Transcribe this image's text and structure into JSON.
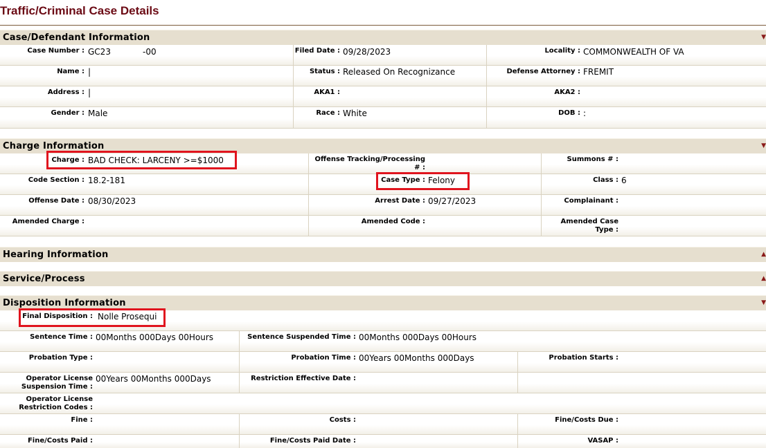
{
  "page": {
    "title": "Traffic/Criminal Case Details"
  },
  "sections": {
    "case": "Case/Defendant Information",
    "charge": "Charge Information",
    "hearing": "Hearing Information",
    "service": "Service/Process",
    "disposition": "Disposition Information"
  },
  "toggle_icons": {
    "collapse": "▼",
    "expand": "▲"
  },
  "case": {
    "case_number": {
      "label": "Case Number :",
      "value": "GC23",
      "suffix": "-00"
    },
    "filed_date": {
      "label": "Filed Date :",
      "value": "09/28/2023"
    },
    "locality": {
      "label": "Locality :",
      "value": "COMMONWEALTH OF VA"
    },
    "name": {
      "label": "Name :",
      "value": "|"
    },
    "status": {
      "label": "Status :",
      "value": "Released On Recognizance"
    },
    "defense_attorney": {
      "label": "Defense Attorney :",
      "value": "FREMIT"
    },
    "address": {
      "label": "Address :",
      "value": "|"
    },
    "aka1": {
      "label": "AKA1 :",
      "value": ""
    },
    "aka2": {
      "label": "AKA2 :",
      "value": ""
    },
    "gender": {
      "label": "Gender :",
      "value": "Male"
    },
    "race": {
      "label": "Race :",
      "value": "White"
    },
    "dob": {
      "label": "DOB :",
      "value": ":"
    }
  },
  "charge": {
    "charge": {
      "label": "Charge :",
      "value": "BAD CHECK: LARCENY >=$1000"
    },
    "offense_tracking_line1": "Offense Tracking/Processing",
    "offense_tracking_line2": "# :",
    "offense_tracking_value": "",
    "summons": {
      "label": "Summons # :",
      "value": ""
    },
    "code_section": {
      "label": "Code Section :",
      "value": "18.2-181"
    },
    "case_type": {
      "label": "Case Type :",
      "value": "Felony"
    },
    "class": {
      "label": "Class :",
      "value": "6"
    },
    "offense_date": {
      "label": "Offense Date :",
      "value": "08/30/2023"
    },
    "arrest_date": {
      "label": "Arrest Date :",
      "value": "09/27/2023"
    },
    "complainant": {
      "label": "Complainant :",
      "value": ""
    },
    "amended_charge": {
      "label": "Amended Charge :",
      "value": ""
    },
    "amended_code": {
      "label": "Amended Code :",
      "value": ""
    },
    "amended_case_type_line1": "Amended Case",
    "amended_case_type_line2": "Type :"
  },
  "disposition": {
    "final_disposition": {
      "label": "Final Disposition :",
      "value": "Nolle Prosequi"
    },
    "sentence_time": {
      "label": "Sentence Time :",
      "value": "00Months 000Days 00Hours"
    },
    "sentence_suspended_time": {
      "label": "Sentence Suspended Time :",
      "value": "00Months 000Days 00Hours"
    },
    "probation_type": {
      "label": "Probation Type :",
      "value": ""
    },
    "probation_time": {
      "label": "Probation Time :",
      "value": "00Years 00Months 000Days"
    },
    "probation_starts": {
      "label": "Probation Starts :",
      "value": ""
    },
    "op_license_suspension_line1": "Operator License",
    "op_license_suspension_line2": "Suspension Time :",
    "op_license_suspension_value": "00Years 00Months 000Days",
    "restriction_effective_date": {
      "label": "Restriction Effective Date :",
      "value": ""
    },
    "op_license_restriction_line1": "Operator License",
    "op_license_restriction_line2": "Restriction Codes :",
    "fine": {
      "label": "Fine :",
      "value": ""
    },
    "costs": {
      "label": "Costs :",
      "value": ""
    },
    "fine_costs_due": {
      "label": "Fine/Costs Due :",
      "value": ""
    },
    "fine_costs_paid": {
      "label": "Fine/Costs Paid :",
      "value": ""
    },
    "fine_costs_paid_date": {
      "label": "Fine/Costs Paid Date :",
      "value": ""
    },
    "vasap": {
      "label": "VASAP :",
      "value": ""
    }
  },
  "colors": {
    "title": "#6b0a14",
    "section_bg": "#e6dfcf",
    "highlight": "#e0141e"
  }
}
